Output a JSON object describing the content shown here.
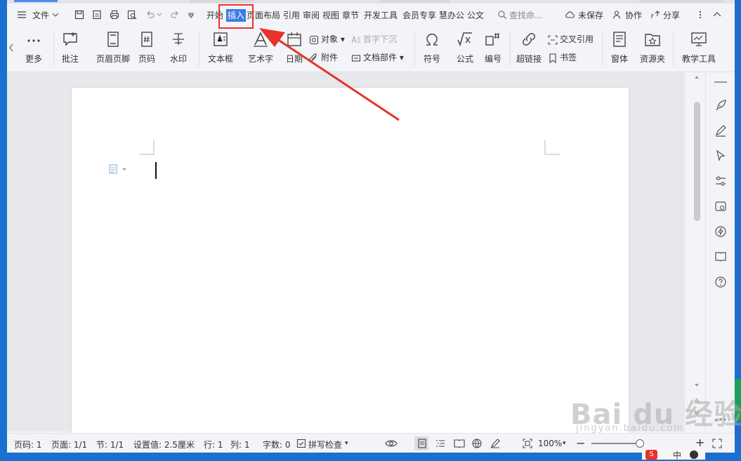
{
  "menubar": {
    "file": "文件",
    "tabs": [
      "开始",
      "插入",
      "页面布局",
      "引用",
      "审阅",
      "视图",
      "章节",
      "开发工具",
      "会员专享",
      "慧办公",
      "公文"
    ],
    "search_placeholder": "查找命...",
    "unsaved": "未保存",
    "collaborate": "协作",
    "share": "分享"
  },
  "ribbon": {
    "more": "更多",
    "comment": "批注",
    "header_footer": "页眉页脚",
    "page_number": "页码",
    "watermark": "水印",
    "textbox": "文本框",
    "wordart": "艺术字",
    "date": "日期",
    "object": "对象",
    "drop_cap": "首字下沉",
    "attachment": "附件",
    "doc_parts": "文档部件",
    "symbol": "符号",
    "formula": "公式",
    "numbering": "编号",
    "hyperlink": "超链接",
    "cross_ref": "交叉引用",
    "bookmark": "书签",
    "form": "窗体",
    "resources": "资源夹",
    "teaching_tools": "教学工具"
  },
  "status": {
    "page_num": "页码: 1",
    "pages": "页面: 1/1",
    "section": "节: 1/1",
    "position": "设置值: 2.5厘米",
    "row": "行: 1",
    "col": "列: 1",
    "word_count": "字数: 0",
    "spellcheck": "拼写检查",
    "zoom": "100%"
  },
  "ime": {
    "lang": "中"
  },
  "watermark": {
    "brand": "Bai du 经验",
    "url": "jingyan.baidu.com"
  }
}
